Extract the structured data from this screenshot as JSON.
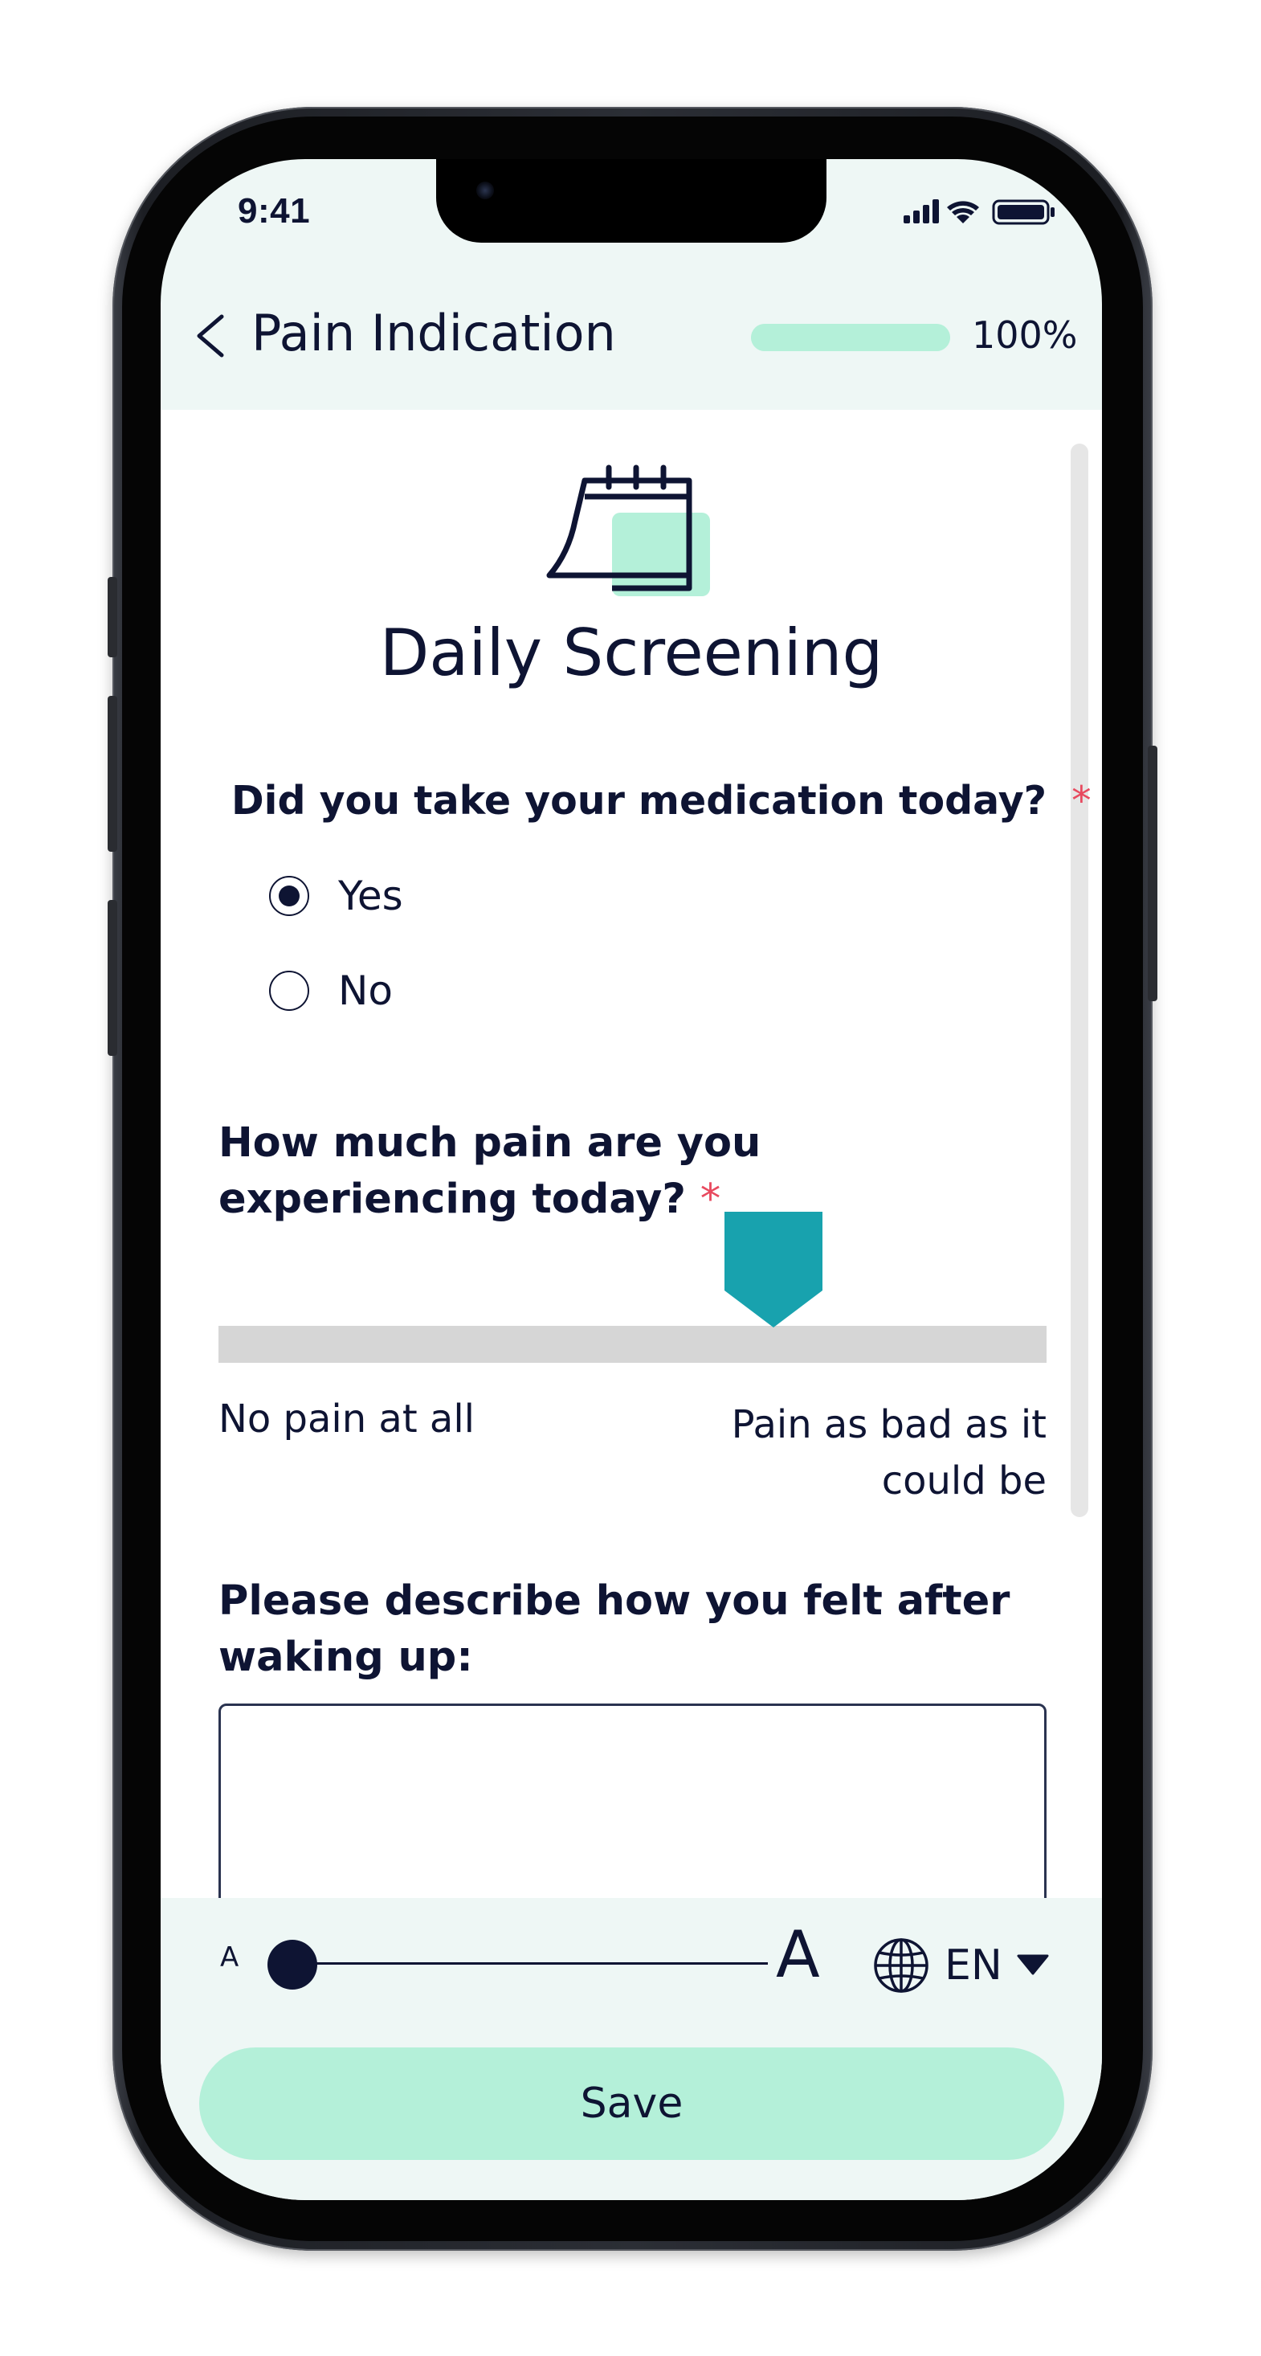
{
  "status_bar": {
    "time": "9:41"
  },
  "header": {
    "title": "Pain Indication",
    "progress_percent": 100,
    "progress_label": "100%"
  },
  "screen": {
    "title": "Daily Screening",
    "hero_icon": "calendar-icon"
  },
  "questions": {
    "medication": {
      "label": "Did you take your medication today?",
      "required_mark": "*",
      "options": [
        "Yes",
        "No"
      ],
      "selected": "Yes"
    },
    "pain": {
      "label": "How much pain are you experiencing today?",
      "required_mark": "*",
      "scale_min_label": "No pain at all",
      "scale_max_label": "Pain as bad as it could be",
      "value_fraction": 0.67
    },
    "wake_feeling": {
      "label": "Please describe how you felt after waking up:",
      "value": ""
    }
  },
  "accessibility": {
    "font_small_label": "A",
    "font_large_label": "A",
    "font_scale_fraction": 0.0
  },
  "language": {
    "selected": "EN"
  },
  "actions": {
    "save_label": "Save"
  },
  "colors": {
    "accent_mint": "#b4f0d9",
    "slider_thumb_teal": "#18a2ae",
    "text_navy": "#0e1433",
    "required_red": "#e84a5f"
  }
}
